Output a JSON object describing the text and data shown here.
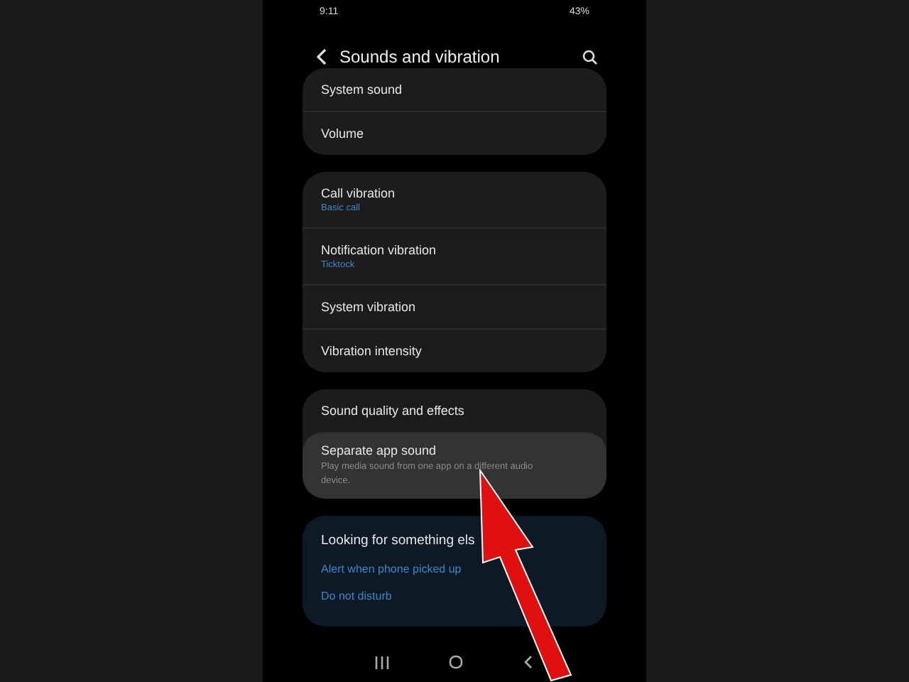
{
  "status_bar": {
    "time": "9:11",
    "battery": "43%"
  },
  "header": {
    "title": "Sounds and vibration"
  },
  "groups": [
    {
      "items": [
        {
          "label": "System sound",
          "selected": false
        },
        {
          "label": "Volume",
          "selected": false
        }
      ]
    },
    {
      "items": [
        {
          "label": "Call vibration",
          "value": "Basic call",
          "selected": false
        },
        {
          "label": "Notification vibration",
          "value": "Ticktock",
          "selected": false
        },
        {
          "label": "System vibration",
          "selected": false
        },
        {
          "label": "Vibration intensity",
          "selected": false
        }
      ]
    },
    {
      "items": [
        {
          "label": "Sound quality and effects",
          "selected": false
        },
        {
          "label": "Separate app sound",
          "description": "Play media sound from one app on a different audio device.",
          "selected": true
        }
      ]
    }
  ],
  "suggestions": {
    "title": "Looking for something els",
    "links": [
      "Alert when phone picked up",
      "Do not disturb"
    ]
  }
}
